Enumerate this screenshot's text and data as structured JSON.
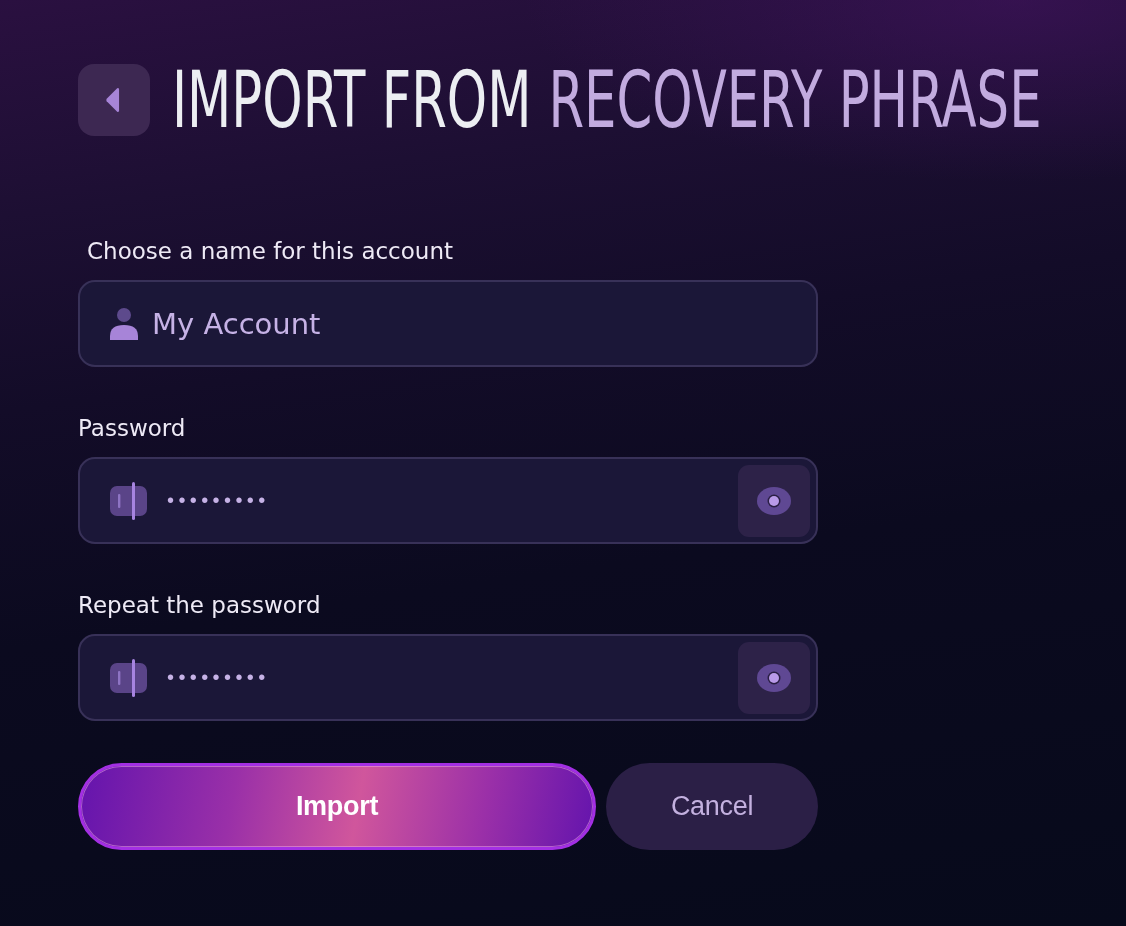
{
  "title": {
    "main": "IMPORT FROM",
    "accent": "RECOVERY PHRASE"
  },
  "fields": [
    {
      "kind": "text",
      "label": "Choose a name for this account",
      "value": "My Account"
    },
    {
      "kind": "password",
      "label": "Password",
      "value": "•••••••••"
    },
    {
      "kind": "password",
      "label": "Repeat the password",
      "value": "•••••••••"
    }
  ],
  "buttons": [
    {
      "kind": "primary",
      "label": "Import"
    },
    {
      "kind": "secondary",
      "label": "Cancel"
    }
  ]
}
